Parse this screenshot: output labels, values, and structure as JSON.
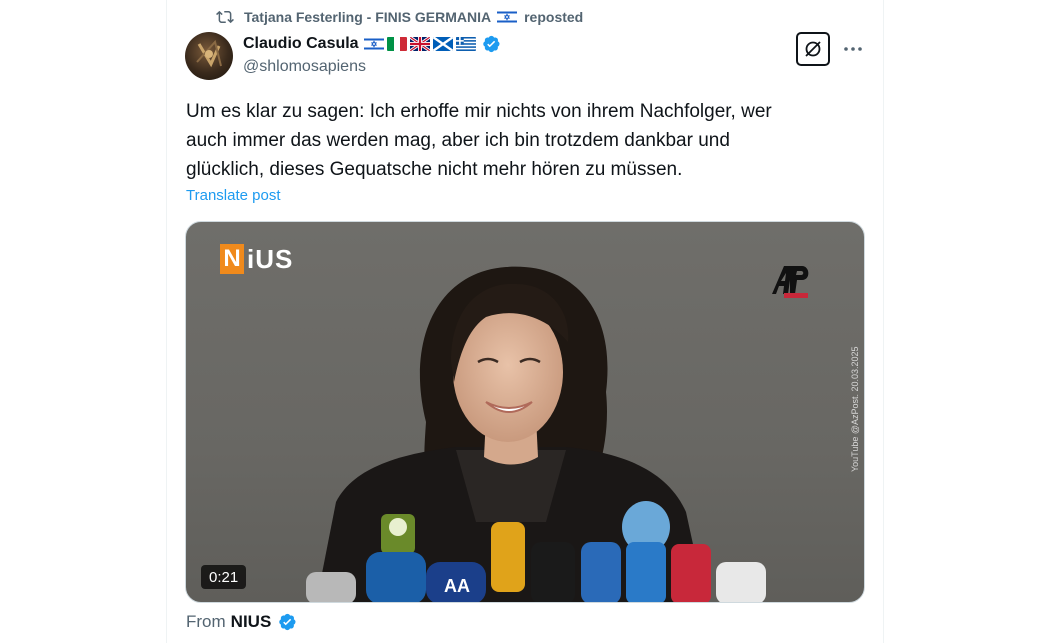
{
  "repost": {
    "user_name": "Tatjana Festerling - FINIS GERMANIA",
    "label": "reposted",
    "flags": [
      "israel-flag"
    ]
  },
  "author": {
    "name": "Claudio Casula",
    "handle": "@shlomosapiens",
    "flags": [
      "israel-flag",
      "italy-flag",
      "uk-flag",
      "scotland-flag",
      "greece-flag"
    ],
    "verified": true
  },
  "post": {
    "text": "Um es klar zu sagen: Ich erhoffe mir nichts von ihrem Nachfolger, wer\nauch immer das werden mag, aber ich bin trotzdem dankbar und\nglücklich, dieses Gequatsche nicht mehr hören zu müssen.",
    "translate_label": "Translate post"
  },
  "video": {
    "watermark_n": "N",
    "watermark_rest": "iUS",
    "credit": "YouTube @AzPost. 20.03.2025",
    "duration": "0:21"
  },
  "source": {
    "prefix": "From",
    "name": "NIUS",
    "verified": true
  },
  "colors": {
    "accent": "#1d9bf0",
    "text": "#0f1419",
    "secondary": "#536471",
    "nius_orange": "#f08a1c"
  }
}
